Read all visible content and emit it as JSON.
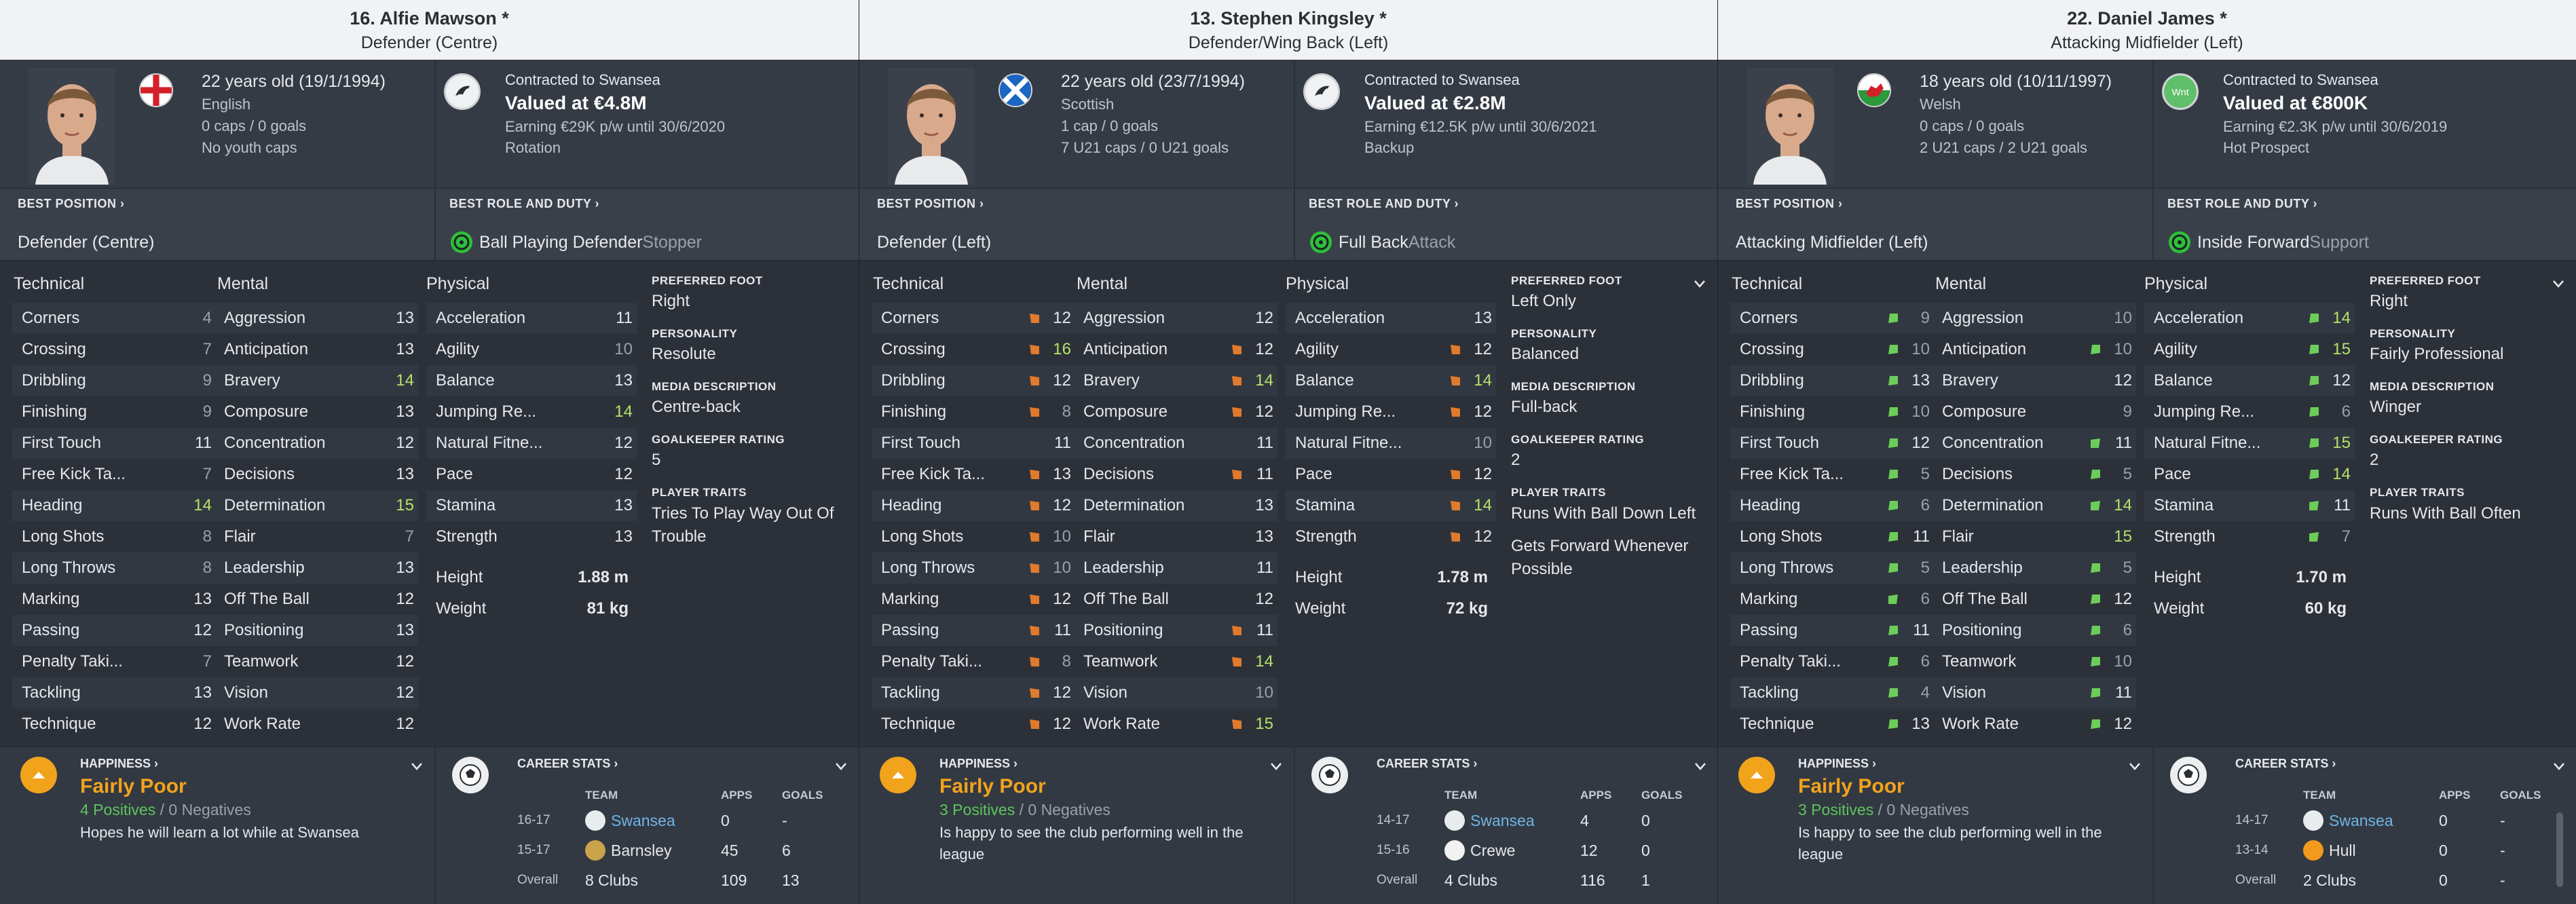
{
  "players": [
    {
      "title": "16. Alfie Mawson *",
      "position_title": "Defender (Centre)",
      "flag": "england",
      "age_line": "22 years old (19/1/1994)",
      "info_lines": [
        "English",
        "0 caps / 0 goals",
        "No youth caps"
      ],
      "badge": "swansea",
      "contract": "Contracted to Swansea",
      "value": "Valued at €4.8M",
      "earning": "Earning €29K p/w until 30/6/2020",
      "status": "Rotation",
      "best_position_label": "BEST POSITION ›",
      "best_position": "Defender (Centre)",
      "best_role_label": "BEST ROLE AND DUTY ›",
      "role": "Ball Playing Defender",
      "duty": "Stopper",
      "headers": {
        "technical": "Technical",
        "mental": "Mental",
        "physical": "Physical"
      },
      "technical": [
        {
          "name": "Corners",
          "value": "4",
          "color": "#9aa1a9"
        },
        {
          "name": "Crossing",
          "value": "7",
          "color": "#9aa1a9"
        },
        {
          "name": "Dribbling",
          "value": "9",
          "color": "#9aa1a9"
        },
        {
          "name": "Finishing",
          "value": "9",
          "color": "#9aa1a9"
        },
        {
          "name": "First Touch",
          "value": "11",
          "color": "#e6e8eb"
        },
        {
          "name": "Free Kick Ta...",
          "value": "7",
          "color": "#9aa1a9"
        },
        {
          "name": "Heading",
          "value": "14",
          "color": "#b5e26a"
        },
        {
          "name": "Long Shots",
          "value": "8",
          "color": "#9aa1a9"
        },
        {
          "name": "Long Throws",
          "value": "8",
          "color": "#9aa1a9"
        },
        {
          "name": "Marking",
          "value": "13",
          "color": "#e6e8eb"
        },
        {
          "name": "Passing",
          "value": "12",
          "color": "#e6e8eb"
        },
        {
          "name": "Penalty Taki...",
          "value": "7",
          "color": "#9aa1a9"
        },
        {
          "name": "Tackling",
          "value": "13",
          "color": "#e6e8eb"
        },
        {
          "name": "Technique",
          "value": "12",
          "color": "#e6e8eb"
        }
      ],
      "mental": [
        {
          "name": "Aggression",
          "value": "13",
          "color": "#e6e8eb"
        },
        {
          "name": "Anticipation",
          "value": "13",
          "color": "#e6e8eb"
        },
        {
          "name": "Bravery",
          "value": "14",
          "color": "#b5e26a"
        },
        {
          "name": "Composure",
          "value": "13",
          "color": "#e6e8eb"
        },
        {
          "name": "Concentration",
          "value": "12",
          "color": "#e6e8eb"
        },
        {
          "name": "Decisions",
          "value": "13",
          "color": "#e6e8eb"
        },
        {
          "name": "Determination",
          "value": "15",
          "color": "#b5e26a"
        },
        {
          "name": "Flair",
          "value": "7",
          "color": "#9aa1a9"
        },
        {
          "name": "Leadership",
          "value": "13",
          "color": "#e6e8eb"
        },
        {
          "name": "Off The Ball",
          "value": "12",
          "color": "#e6e8eb"
        },
        {
          "name": "Positioning",
          "value": "13",
          "color": "#e6e8eb"
        },
        {
          "name": "Teamwork",
          "value": "12",
          "color": "#e6e8eb"
        },
        {
          "name": "Vision",
          "value": "12",
          "color": "#e6e8eb"
        },
        {
          "name": "Work Rate",
          "value": "12",
          "color": "#e6e8eb"
        }
      ],
      "physical": [
        {
          "name": "Acceleration",
          "value": "11",
          "color": "#e6e8eb"
        },
        {
          "name": "Agility",
          "value": "10",
          "color": "#9aa1a9"
        },
        {
          "name": "Balance",
          "value": "13",
          "color": "#e6e8eb"
        },
        {
          "name": "Jumping Re...",
          "value": "14",
          "color": "#b5e26a"
        },
        {
          "name": "Natural Fitne...",
          "value": "12",
          "color": "#e6e8eb"
        },
        {
          "name": "Pace",
          "value": "12",
          "color": "#e6e8eb"
        },
        {
          "name": "Stamina",
          "value": "13",
          "color": "#e6e8eb"
        },
        {
          "name": "Strength",
          "value": "13",
          "color": "#e6e8eb"
        }
      ],
      "height_label": "Height",
      "height": "1.88 m",
      "weight_label": "Weight",
      "weight": "81 kg",
      "foot_label": "PREFERRED FOOT",
      "foot": "Right",
      "personality_label": "PERSONALITY",
      "personality": "Resolute",
      "media_label": "MEDIA DESCRIPTION",
      "media": "Centre-back",
      "gk_label": "GOALKEEPER RATING",
      "gk": "5",
      "traits_label": "PLAYER TRAITS",
      "traits": [
        "Tries To Play Way Out Of Trouble"
      ],
      "happiness_label": "HAPPINESS ›",
      "happiness": "Fairly Poor",
      "positives": "4 Positives",
      "negatives": " / 0 Negatives",
      "happiness_desc": "Hopes he will learn a lot while at Swansea",
      "career_label": "CAREER STATS ›",
      "career_head": {
        "team": "TEAM",
        "apps": "APPS",
        "goals": "GOALS"
      },
      "career": [
        {
          "year": "16-17",
          "team": "Swansea",
          "apps": "0",
          "goals": "-",
          "badge": "swansea",
          "link": true
        },
        {
          "year": "15-17",
          "team": "Barnsley",
          "apps": "45",
          "goals": "6",
          "badge": "barnsley",
          "link": false
        },
        {
          "year": "Overall",
          "team": "8 Clubs",
          "apps": "109",
          "goals": "13",
          "badge": "",
          "link": false
        }
      ]
    },
    {
      "title": "13. Stephen Kingsley *",
      "position_title": "Defender/Wing Back (Left)",
      "flag": "scotland",
      "age_line": "22 years old (23/7/1994)",
      "info_lines": [
        "Scottish",
        "1 cap / 0 goals",
        "7 U21 caps / 0 U21 goals"
      ],
      "badge": "swansea",
      "contract": "Contracted to Swansea",
      "value": "Valued at €2.8M",
      "earning": "Earning €12.5K p/w until 30/6/2021",
      "status": "Backup",
      "best_position_label": "BEST POSITION ›",
      "best_position": "Defender (Left)",
      "best_role_label": "BEST ROLE AND DUTY ›",
      "role": "Full Back",
      "duty": "Attack",
      "headers": {
        "technical": "Technical",
        "mental": "Mental",
        "physical": "Physical"
      },
      "technical": [
        {
          "name": "Corners",
          "value": "12",
          "color": "#e6e8eb",
          "arrow": "down"
        },
        {
          "name": "Crossing",
          "value": "16",
          "color": "#b5e26a",
          "arrow": "down"
        },
        {
          "name": "Dribbling",
          "value": "12",
          "color": "#e6e8eb",
          "arrow": "down"
        },
        {
          "name": "Finishing",
          "value": "8",
          "color": "#9aa1a9",
          "arrow": "down"
        },
        {
          "name": "First Touch",
          "value": "11",
          "color": "#e6e8eb"
        },
        {
          "name": "Free Kick Ta...",
          "value": "13",
          "color": "#e6e8eb",
          "arrow": "down"
        },
        {
          "name": "Heading",
          "value": "12",
          "color": "#e6e8eb",
          "arrow": "down"
        },
        {
          "name": "Long Shots",
          "value": "10",
          "color": "#9aa1a9",
          "arrow": "down"
        },
        {
          "name": "Long Throws",
          "value": "10",
          "color": "#9aa1a9",
          "arrow": "down"
        },
        {
          "name": "Marking",
          "value": "12",
          "color": "#e6e8eb",
          "arrow": "down"
        },
        {
          "name": "Passing",
          "value": "11",
          "color": "#e6e8eb",
          "arrow": "down"
        },
        {
          "name": "Penalty Taki...",
          "value": "8",
          "color": "#9aa1a9",
          "arrow": "down"
        },
        {
          "name": "Tackling",
          "value": "12",
          "color": "#e6e8eb",
          "arrow": "down"
        },
        {
          "name": "Technique",
          "value": "12",
          "color": "#e6e8eb",
          "arrow": "down"
        }
      ],
      "mental": [
        {
          "name": "Aggression",
          "value": "12",
          "color": "#e6e8eb"
        },
        {
          "name": "Anticipation",
          "value": "12",
          "color": "#e6e8eb",
          "arrow": "down"
        },
        {
          "name": "Bravery",
          "value": "14",
          "color": "#b5e26a",
          "arrow": "down"
        },
        {
          "name": "Composure",
          "value": "12",
          "color": "#e6e8eb",
          "arrow": "down"
        },
        {
          "name": "Concentration",
          "value": "11",
          "color": "#e6e8eb"
        },
        {
          "name": "Decisions",
          "value": "11",
          "color": "#e6e8eb",
          "arrow": "down"
        },
        {
          "name": "Determination",
          "value": "13",
          "color": "#e6e8eb"
        },
        {
          "name": "Flair",
          "value": "13",
          "color": "#e6e8eb"
        },
        {
          "name": "Leadership",
          "value": "11",
          "color": "#e6e8eb"
        },
        {
          "name": "Off The Ball",
          "value": "12",
          "color": "#e6e8eb"
        },
        {
          "name": "Positioning",
          "value": "11",
          "color": "#e6e8eb",
          "arrow": "down"
        },
        {
          "name": "Teamwork",
          "value": "14",
          "color": "#b5e26a",
          "arrow": "down"
        },
        {
          "name": "Vision",
          "value": "10",
          "color": "#9aa1a9"
        },
        {
          "name": "Work Rate",
          "value": "15",
          "color": "#b5e26a",
          "arrow": "down"
        }
      ],
      "physical": [
        {
          "name": "Acceleration",
          "value": "13",
          "color": "#e6e8eb"
        },
        {
          "name": "Agility",
          "value": "12",
          "color": "#e6e8eb",
          "arrow": "down"
        },
        {
          "name": "Balance",
          "value": "14",
          "color": "#b5e26a",
          "arrow": "down"
        },
        {
          "name": "Jumping Re...",
          "value": "12",
          "color": "#e6e8eb",
          "arrow": "down"
        },
        {
          "name": "Natural Fitne...",
          "value": "10",
          "color": "#9aa1a9"
        },
        {
          "name": "Pace",
          "value": "12",
          "color": "#e6e8eb",
          "arrow": "down"
        },
        {
          "name": "Stamina",
          "value": "14",
          "color": "#b5e26a",
          "arrow": "down"
        },
        {
          "name": "Strength",
          "value": "12",
          "color": "#e6e8eb",
          "arrow": "down"
        }
      ],
      "height_label": "Height",
      "height": "1.78 m",
      "weight_label": "Weight",
      "weight": "72 kg",
      "foot_label": "PREFERRED FOOT",
      "foot": "Left Only",
      "personality_label": "PERSONALITY",
      "personality": "Balanced",
      "media_label": "MEDIA DESCRIPTION",
      "media": "Full-back",
      "gk_label": "GOALKEEPER RATING",
      "gk": "2",
      "traits_label": "PLAYER TRAITS",
      "traits": [
        "Runs With Ball Down Left",
        "Gets Forward Whenever Possible"
      ],
      "happiness_label": "HAPPINESS ›",
      "happiness": "Fairly Poor",
      "positives": "3 Positives",
      "negatives": " / 0 Negatives",
      "happiness_desc": "Is happy to see the club performing well in the league",
      "career_label": "CAREER STATS ›",
      "career_head": {
        "team": "TEAM",
        "apps": "APPS",
        "goals": "GOALS"
      },
      "career": [
        {
          "year": "14-17",
          "team": "Swansea",
          "apps": "4",
          "goals": "0",
          "badge": "swansea",
          "link": true
        },
        {
          "year": "15-16",
          "team": "Crewe",
          "apps": "12",
          "goals": "0",
          "badge": "crewe",
          "link": false
        },
        {
          "year": "Overall",
          "team": "4 Clubs",
          "apps": "116",
          "goals": "1",
          "badge": "",
          "link": false
        }
      ]
    },
    {
      "title": "22. Daniel James *",
      "position_title": "Attacking Midfielder (Left)",
      "flag": "wales",
      "age_line": "18 years old (10/11/1997)",
      "info_lines": [
        "Welsh",
        "0 caps / 0 goals",
        "2 U21 caps / 2 U21 goals"
      ],
      "badge": "wnt",
      "badge_text": "Wnt",
      "contract": "Contracted to Swansea",
      "value": "Valued at €800K",
      "earning": "Earning €2.3K p/w until 30/6/2019",
      "status": "Hot Prospect",
      "best_position_label": "BEST POSITION ›",
      "best_position": "Attacking Midfielder (Left)",
      "best_role_label": "BEST ROLE AND DUTY ›",
      "role": "Inside Forward",
      "duty": "Support",
      "headers": {
        "technical": "Technical",
        "mental": "Mental",
        "physical": "Physical"
      },
      "technical": [
        {
          "name": "Corners",
          "value": "9",
          "color": "#9aa1a9",
          "arrow": "up"
        },
        {
          "name": "Crossing",
          "value": "10",
          "color": "#9aa1a9",
          "arrow": "up"
        },
        {
          "name": "Dribbling",
          "value": "13",
          "color": "#e6e8eb",
          "arrow": "up"
        },
        {
          "name": "Finishing",
          "value": "10",
          "color": "#9aa1a9",
          "arrow": "up"
        },
        {
          "name": "First Touch",
          "value": "12",
          "color": "#e6e8eb",
          "arrow": "up"
        },
        {
          "name": "Free Kick Ta...",
          "value": "5",
          "color": "#9aa1a9",
          "arrow": "up"
        },
        {
          "name": "Heading",
          "value": "6",
          "color": "#9aa1a9",
          "arrow": "up"
        },
        {
          "name": "Long Shots",
          "value": "11",
          "color": "#e6e8eb",
          "arrow": "up"
        },
        {
          "name": "Long Throws",
          "value": "5",
          "color": "#9aa1a9",
          "arrow": "up"
        },
        {
          "name": "Marking",
          "value": "6",
          "color": "#9aa1a9",
          "arrow": "upleft"
        },
        {
          "name": "Passing",
          "value": "11",
          "color": "#e6e8eb",
          "arrow": "up"
        },
        {
          "name": "Penalty Taki...",
          "value": "6",
          "color": "#9aa1a9",
          "arrow": "up"
        },
        {
          "name": "Tackling",
          "value": "4",
          "color": "#9aa1a9",
          "arrow": "up"
        },
        {
          "name": "Technique",
          "value": "13",
          "color": "#e6e8eb",
          "arrow": "up"
        }
      ],
      "mental": [
        {
          "name": "Aggression",
          "value": "10",
          "color": "#9aa1a9"
        },
        {
          "name": "Anticipation",
          "value": "10",
          "color": "#9aa1a9",
          "arrow": "up"
        },
        {
          "name": "Bravery",
          "value": "12",
          "color": "#e6e8eb"
        },
        {
          "name": "Composure",
          "value": "9",
          "color": "#9aa1a9"
        },
        {
          "name": "Concentration",
          "value": "11",
          "color": "#e6e8eb",
          "arrow": "upleft"
        },
        {
          "name": "Decisions",
          "value": "5",
          "color": "#9aa1a9",
          "arrow": "up"
        },
        {
          "name": "Determination",
          "value": "14",
          "color": "#b5e26a",
          "arrow": "upleft"
        },
        {
          "name": "Flair",
          "value": "15",
          "color": "#b5e26a"
        },
        {
          "name": "Leadership",
          "value": "5",
          "color": "#9aa1a9",
          "arrow": "up"
        },
        {
          "name": "Off The Ball",
          "value": "12",
          "color": "#e6e8eb",
          "arrow": "up"
        },
        {
          "name": "Positioning",
          "value": "6",
          "color": "#9aa1a9",
          "arrow": "up"
        },
        {
          "name": "Teamwork",
          "value": "10",
          "color": "#9aa1a9",
          "arrow": "up"
        },
        {
          "name": "Vision",
          "value": "11",
          "color": "#e6e8eb",
          "arrow": "up"
        },
        {
          "name": "Work Rate",
          "value": "12",
          "color": "#e6e8eb",
          "arrow": "up"
        }
      ],
      "physical": [
        {
          "name": "Acceleration",
          "value": "14",
          "color": "#b5e26a",
          "arrow": "up"
        },
        {
          "name": "Agility",
          "value": "15",
          "color": "#b5e26a",
          "arrow": "up"
        },
        {
          "name": "Balance",
          "value": "12",
          "color": "#e6e8eb",
          "arrow": "up"
        },
        {
          "name": "Jumping Re...",
          "value": "6",
          "color": "#9aa1a9",
          "arrow": "up"
        },
        {
          "name": "Natural Fitne...",
          "value": "15",
          "color": "#b5e26a",
          "arrow": "up"
        },
        {
          "name": "Pace",
          "value": "14",
          "color": "#b5e26a",
          "arrow": "up"
        },
        {
          "name": "Stamina",
          "value": "11",
          "color": "#e6e8eb",
          "arrow": "upleft"
        },
        {
          "name": "Strength",
          "value": "7",
          "color": "#9aa1a9",
          "arrow": "upleft"
        }
      ],
      "height_label": "Height",
      "height": "1.70 m",
      "weight_label": "Weight",
      "weight": "60 kg",
      "foot_label": "PREFERRED FOOT",
      "foot": "Right",
      "personality_label": "PERSONALITY",
      "personality": "Fairly Professional",
      "media_label": "MEDIA DESCRIPTION",
      "media": "Winger",
      "gk_label": "GOALKEEPER RATING",
      "gk": "2",
      "traits_label": "PLAYER TRAITS",
      "traits": [
        "Runs With Ball Often"
      ],
      "happiness_label": "HAPPINESS ›",
      "happiness": "Fairly Poor",
      "positives": "3 Positives",
      "negatives": " / 0 Negatives",
      "happiness_desc": "Is happy to see the club performing well in the league",
      "career_label": "CAREER STATS ›",
      "career_head": {
        "team": "TEAM",
        "apps": "APPS",
        "goals": "GOALS"
      },
      "career": [
        {
          "year": "14-17",
          "team": "Swansea",
          "apps": "0",
          "goals": "-",
          "badge": "swansea",
          "link": true
        },
        {
          "year": "13-14",
          "team": "Hull",
          "apps": "0",
          "goals": "-",
          "badge": "hull",
          "link": false
        },
        {
          "year": "Overall",
          "team": "2 Clubs",
          "apps": "0",
          "goals": "-",
          "badge": "",
          "link": false
        }
      ]
    }
  ]
}
